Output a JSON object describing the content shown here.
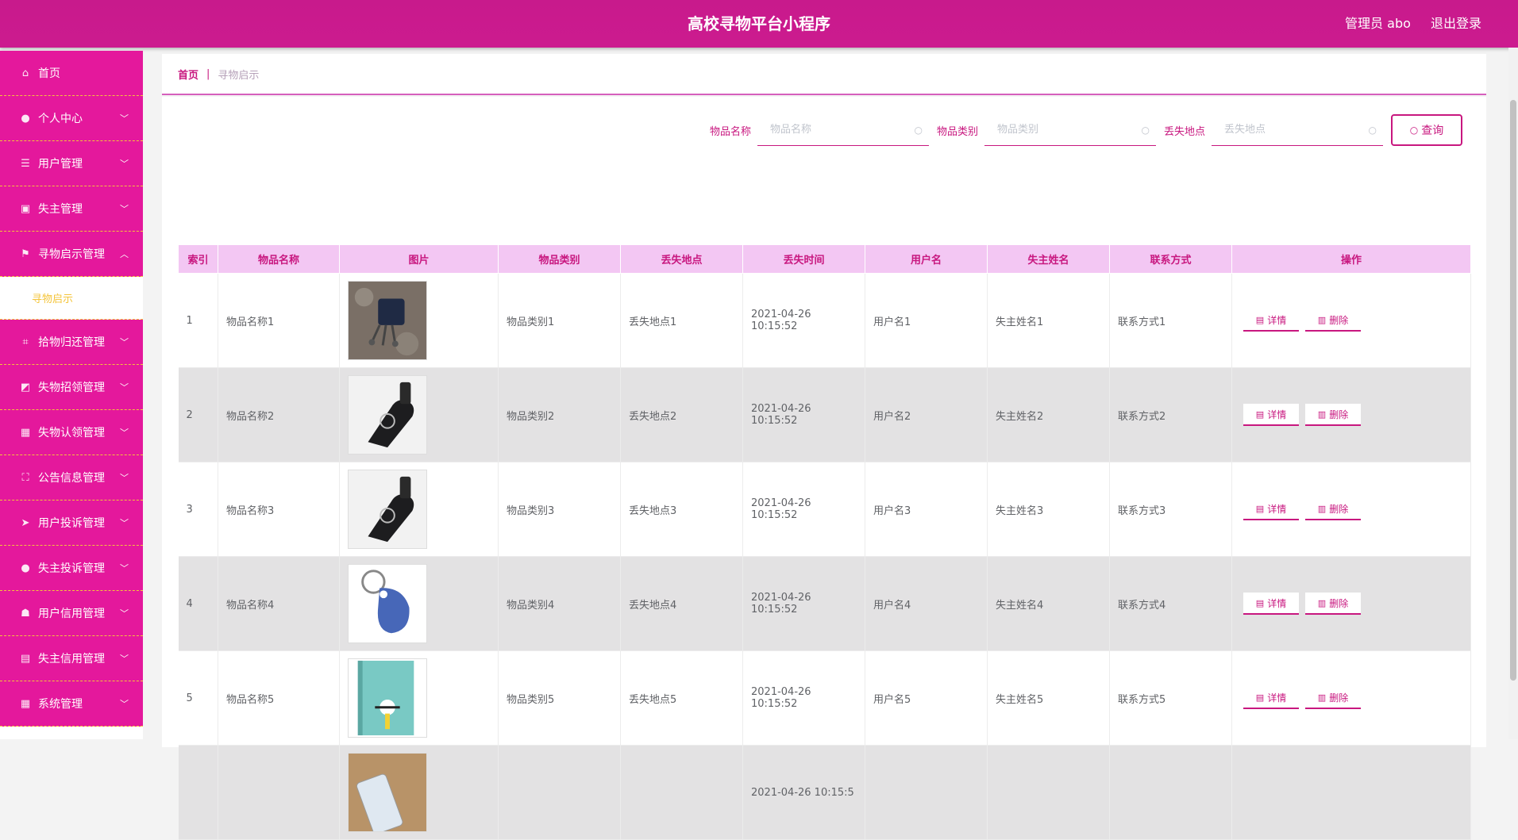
{
  "header": {
    "title": "高校寻物平台小程序",
    "user_label": "管理员 abo",
    "logout_label": "退出登录"
  },
  "sidebar": {
    "items": [
      {
        "label": "首页",
        "icon": "home-icon"
      },
      {
        "label": "个人中心",
        "icon": "user-icon"
      },
      {
        "label": "用户管理",
        "icon": "list-icon"
      },
      {
        "label": "失主管理",
        "icon": "briefcase-icon"
      },
      {
        "label": "寻物启示管理",
        "icon": "flag-icon"
      },
      {
        "label": "寻物启示",
        "icon": ""
      },
      {
        "label": "拾物归还管理",
        "icon": "crop-icon"
      },
      {
        "label": "失物招领管理",
        "icon": "chart-icon"
      },
      {
        "label": "失物认领管理",
        "icon": "grid-icon"
      },
      {
        "label": "公告信息管理",
        "icon": "fullscreen-icon"
      },
      {
        "label": "用户投诉管理",
        "icon": "send-icon"
      },
      {
        "label": "失主投诉管理",
        "icon": "location-icon"
      },
      {
        "label": "用户信用管理",
        "icon": "thumb-icon"
      },
      {
        "label": "失主信用管理",
        "icon": "clipboard-icon"
      },
      {
        "label": "系统管理",
        "icon": "apps-icon"
      }
    ]
  },
  "breadcrumb": {
    "home": "首页",
    "separator": "|",
    "current": "寻物启示"
  },
  "filters": {
    "name_label": "物品名称",
    "name_placeholder": "物品名称",
    "category_label": "物品类别",
    "category_placeholder": "物品类别",
    "location_label": "丢失地点",
    "location_placeholder": "丢失地点",
    "query_label": "查询"
  },
  "table": {
    "headers": [
      "索引",
      "物品名称",
      "图片",
      "物品类别",
      "丢失地点",
      "丢失时间",
      "用户名",
      "失主姓名",
      "联系方式",
      "操作"
    ],
    "detail_label": "详情",
    "delete_label": "删除",
    "rows": [
      {
        "index": "1",
        "name": "物品名称1",
        "image": "wallet-with-keys",
        "category": "物品类别1",
        "location": "丢失地点1",
        "time": "2021-04-26 10:15:52",
        "username": "用户名1",
        "owner": "失主姓名1",
        "contact": "联系方式1"
      },
      {
        "index": "2",
        "name": "物品名称2",
        "image": "car-key",
        "category": "物品类别2",
        "location": "丢失地点2",
        "time": "2021-04-26 10:15:52",
        "username": "用户名2",
        "owner": "失主姓名2",
        "contact": "联系方式2"
      },
      {
        "index": "3",
        "name": "物品名称3",
        "image": "car-key",
        "category": "物品类别3",
        "location": "丢失地点3",
        "time": "2021-04-26 10:15:52",
        "username": "用户名3",
        "owner": "失主姓名3",
        "contact": "联系方式3"
      },
      {
        "index": "4",
        "name": "物品名称4",
        "image": "blue-key-fob",
        "category": "物品类别4",
        "location": "丢失地点4",
        "time": "2021-04-26 10:15:52",
        "username": "用户名4",
        "owner": "失主姓名4",
        "contact": "联系方式4"
      },
      {
        "index": "5",
        "name": "物品名称5",
        "image": "book-cover",
        "category": "物品类别5",
        "location": "丢失地点5",
        "time": "2021-04-26 10:15:52",
        "username": "用户名5",
        "owner": "失主姓名5",
        "contact": "联系方式5"
      },
      {
        "index": "",
        "name": "",
        "image": "phone",
        "category": "",
        "location": "",
        "time": "2021-04-26 10:15:5",
        "username": "",
        "owner": "",
        "contact": ""
      }
    ]
  },
  "colors": {
    "primary": "#c8177f",
    "menu_bg": "#e4189c",
    "accent_yellow": "#f4c43a",
    "header_row": "#f3c7f3"
  }
}
